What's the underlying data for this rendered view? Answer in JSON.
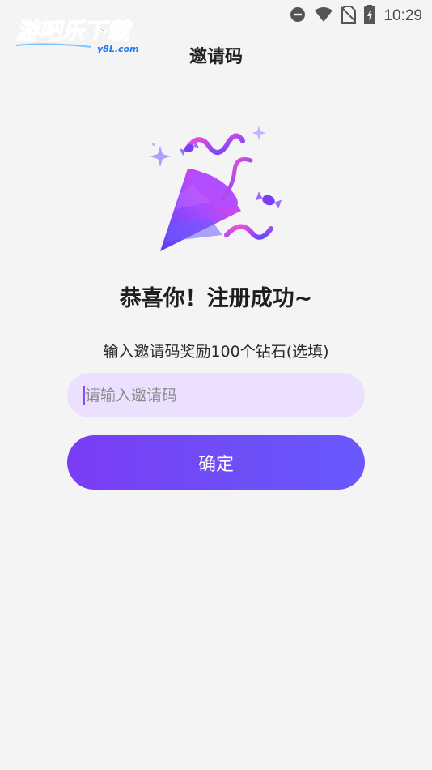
{
  "status_bar": {
    "time": "10:29",
    "icons": [
      "do-not-disturb-icon",
      "wifi-icon",
      "no-sim-icon",
      "battery-charging-icon"
    ]
  },
  "watermark": {
    "brand_text": "游吧乐下载",
    "domain_text": "y8L.com"
  },
  "header": {
    "title": "邀请码"
  },
  "main": {
    "illustration": "party-popper-icon",
    "congrats": "恭喜你！注册成功~",
    "hint": "输入邀请码奖励100个钻石(选填)",
    "invite_input": {
      "value": "",
      "placeholder": "请输入邀请码"
    },
    "confirm_label": "确定"
  },
  "colors": {
    "background": "#f4f4f4",
    "input_background": "#ece0ff",
    "button_gradient_start": "#7a3cf6",
    "button_gradient_end": "#6a58ff",
    "accent": "#8a4cf0"
  }
}
